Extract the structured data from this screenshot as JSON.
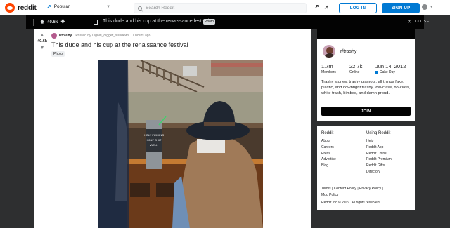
{
  "header": {
    "logo_text": "reddit",
    "feed": "Popular",
    "search_placeholder": "Search Reddit",
    "login_label": "LOG IN",
    "signup_label": "SIGN UP"
  },
  "postbar": {
    "score": "40.6k",
    "title": "This dude and his cup at the renaissance festival",
    "flair": "Photo",
    "close_label": "CLOSE"
  },
  "post": {
    "score": "40.6k",
    "subreddit": "r/trashy",
    "posted_by": "Posted by u/gold_digger_sundews 17 hours ago",
    "title": "This dude and his cup at the renaissance festival",
    "flair": "Photo",
    "cup_text": "HOLY FUCKNG\nHOLY SHIT\nWELL"
  },
  "about": {
    "name": "r/trashy",
    "members_value": "1.7m",
    "members_label": "Members",
    "online_value": "22.7k",
    "online_label": "Online",
    "cake_value": "Jun 14, 2012",
    "cake_label": "Cake Day",
    "description": "Trashy stories, trashy glamour, all things fake, plastic, and downright trashy, low-class, no-class, white trash, bimbos, and damn proud.",
    "join_label": "JOIN"
  },
  "footer": {
    "col1_header": "Reddit",
    "col1_items": [
      "About",
      "Careers",
      "Press",
      "Advertise",
      "Blog"
    ],
    "col2_header": "Using Reddit",
    "col2_items": [
      "Help",
      "Reddit App",
      "Reddit Coins",
      "Reddit Premium",
      "Reddit Gifts",
      "Directory"
    ],
    "legal_1": "Terms  |  Content Policy  |  Privacy Policy  |",
    "legal_2": "Mod Policy",
    "copyright": "Reddit Inc © 2019. All rights reserved"
  },
  "colors": {
    "brand": "#ff4500",
    "accent": "#0079d3",
    "dark": "#030303"
  }
}
